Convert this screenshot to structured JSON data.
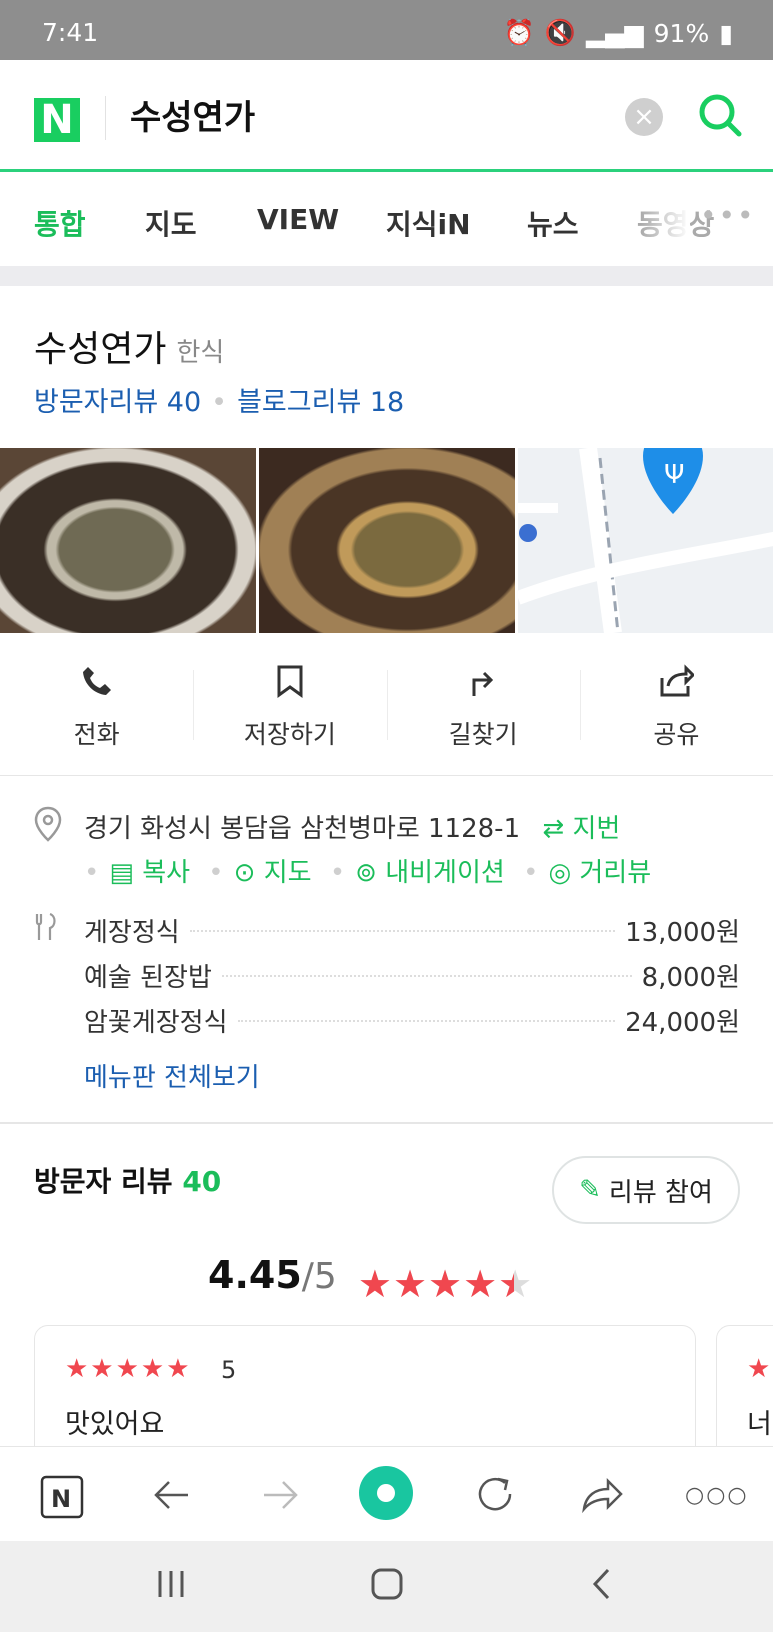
{
  "status_bar": {
    "time": "7:41",
    "battery": "91%"
  },
  "search": {
    "query": "수성연가",
    "clear_symbol": "×"
  },
  "tabs": [
    "통합",
    "지도",
    "VIEW",
    "지식iN",
    "뉴스",
    "동영상"
  ],
  "place": {
    "name": "수성연가",
    "category": "한식",
    "visitor_reviews": "방문자리뷰 40",
    "blog_reviews": "블로그리뷰 18"
  },
  "actions": [
    "전화",
    "저장하기",
    "길찾기",
    "공유"
  ],
  "address": {
    "text": "경기 화성시 봉담읍 삼천병마로 1128-1",
    "jibun": "지번",
    "links": [
      "복사",
      "지도",
      "내비게이션",
      "거리뷰"
    ]
  },
  "menu": [
    {
      "name": "게장정식",
      "price": "13,000원"
    },
    {
      "name": "예술 된장밥",
      "price": "8,000원"
    },
    {
      "name": "암꽃게장정식",
      "price": "24,000원"
    }
  ],
  "menu_link": "메뉴판 전체보기",
  "visitor_section": {
    "title": "방문자 리뷰",
    "count": "40",
    "review_button": "리뷰 참여",
    "score": "4.45",
    "score_max": "5",
    "rating_value": 4.45
  },
  "review_cards": [
    {
      "score": "5",
      "text": "맛있어요"
    },
    {
      "text": "너"
    }
  ],
  "colors": {
    "brand_green": "#19ce60",
    "link_blue": "#1b5eb0",
    "star_red": "#f0474f"
  }
}
